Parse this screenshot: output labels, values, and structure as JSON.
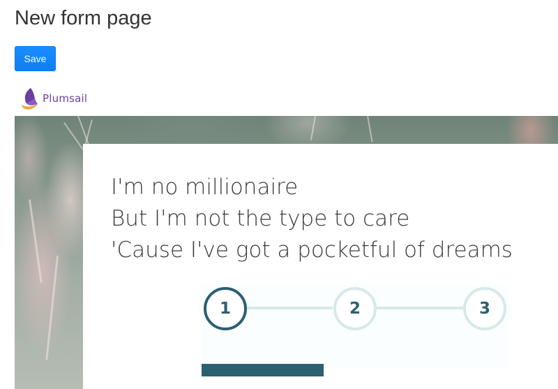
{
  "page": {
    "title": "New form page"
  },
  "toolbar": {
    "save_label": "Save"
  },
  "brand": {
    "name": "Plumsail",
    "icon": "sail-logo-icon",
    "color": "#6b3fa0"
  },
  "form": {
    "lyrics": [
      "I'm no millionaire",
      "But I'm not the type to care",
      "'Cause I've got a pocketful of dreams"
    ],
    "stepper": {
      "steps": [
        "1",
        "2",
        "3"
      ],
      "active_step": 1,
      "active_color": "#2b5f72",
      "inactive_color": "#d5e9e8"
    }
  },
  "colors": {
    "save_button": "#0a84ff",
    "text": "#333333"
  }
}
